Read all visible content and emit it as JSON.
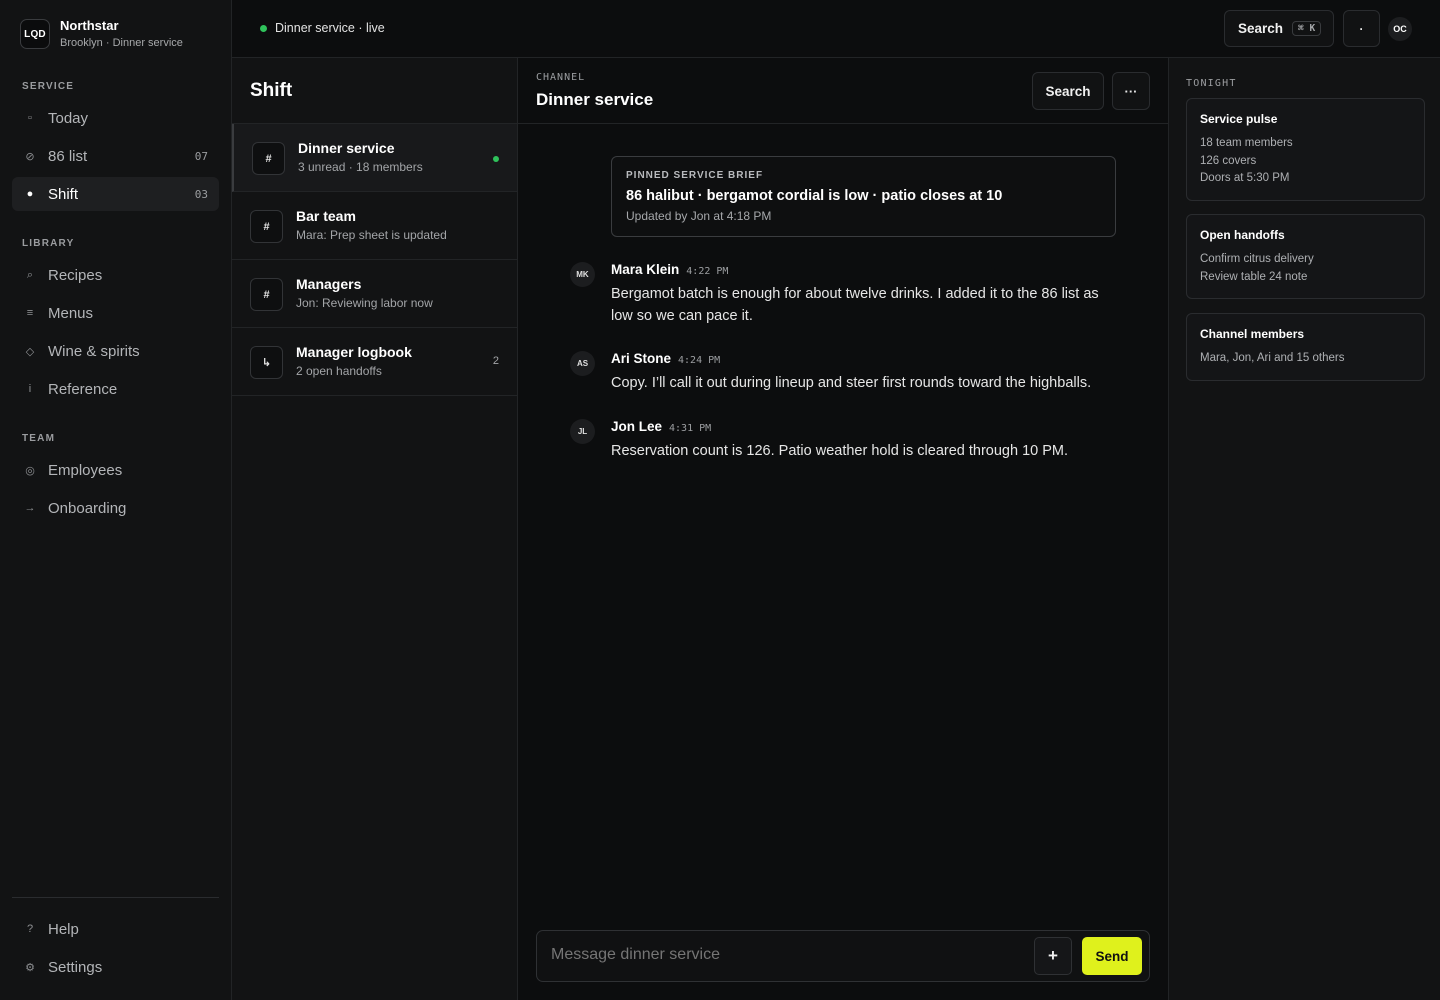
{
  "brand": {
    "logo": "LQD",
    "name": "Northstar",
    "subtitle": "Brooklyn · Dinner service"
  },
  "sidebar": {
    "sections": {
      "service": "SERVICE",
      "library": "LIBRARY",
      "team": "TEAM"
    },
    "service_items": [
      {
        "label": "Today",
        "icon": "calendar-icon",
        "glyph": "▫"
      },
      {
        "label": "86 list",
        "icon": "slash-icon",
        "glyph": "⊘",
        "count": "07"
      },
      {
        "label": "Shift",
        "icon": "radio-icon",
        "glyph": "●",
        "count": "03",
        "active": true
      }
    ],
    "library_items": [
      {
        "label": "Recipes",
        "icon": "search-icon",
        "glyph": "⌕"
      },
      {
        "label": "Menus",
        "icon": "list-icon",
        "glyph": "≡"
      },
      {
        "label": "Wine & spirits",
        "icon": "diamond-icon",
        "glyph": "◇"
      },
      {
        "label": "Reference",
        "icon": "info-icon",
        "glyph": "i"
      }
    ],
    "team_items": [
      {
        "label": "Employees",
        "icon": "people-icon",
        "glyph": "◎"
      },
      {
        "label": "Onboarding",
        "icon": "arrow-right-icon",
        "glyph": "→"
      }
    ],
    "bottom_items": [
      {
        "label": "Help",
        "icon": "help-icon",
        "glyph": "?"
      },
      {
        "label": "Settings",
        "icon": "gear-icon",
        "glyph": "⚙"
      }
    ]
  },
  "topbar": {
    "status": "Dinner service · live",
    "search_label": "Search",
    "shortcut": "⌘ K",
    "dot_button": "·",
    "avatar": "OC"
  },
  "channel_list": {
    "title": "Shift",
    "channels": [
      {
        "icon": "#",
        "name": "Dinner service",
        "sub": "3 unread · 18 members",
        "active": true,
        "live": true
      },
      {
        "icon": "#",
        "name": "Bar team",
        "sub": "Mara: Prep sheet is updated"
      },
      {
        "icon": "#",
        "name": "Managers",
        "sub": "Jon: Reviewing labor now"
      },
      {
        "icon": "↳",
        "name": "Manager logbook",
        "sub": "2 open handoffs",
        "count": "2"
      }
    ]
  },
  "main": {
    "eyebrow": "CHANNEL",
    "title": "Dinner service",
    "search_label": "Search",
    "more_label": "···",
    "pinned": {
      "label": "PINNED SERVICE BRIEF",
      "title": "86 halibut · bergamot cordial is low · patio closes at 10",
      "sub": "Updated by Jon at 4:18 PM"
    },
    "messages": [
      {
        "initials": "MK",
        "author": "Mara Klein",
        "time": "4:22 PM",
        "body": "Bergamot batch is enough for about twelve drinks. I added it to the 86 list as low so we can pace it."
      },
      {
        "initials": "AS",
        "author": "Ari Stone",
        "time": "4:24 PM",
        "body": "Copy. I’ll call it out during lineup and steer first rounds toward the highballs."
      },
      {
        "initials": "JL",
        "author": "Jon Lee",
        "time": "4:31 PM",
        "body": "Reservation count is 126. Patio weather hold is cleared through 10 PM."
      }
    ],
    "composer": {
      "placeholder": "Message dinner service",
      "plus": "+",
      "send": "Send"
    }
  },
  "right_panel": {
    "label": "TONIGHT",
    "cards": [
      {
        "title": "Service pulse",
        "lines": [
          "18 team members",
          "126 covers",
          "Doors at 5:30 PM"
        ]
      },
      {
        "title": "Open handoffs",
        "lines": [
          "Confirm citrus delivery",
          "Review table 24 note"
        ]
      },
      {
        "title": "Channel members",
        "lines": [
          "Mara, Jon, Ari and 15 others"
        ]
      }
    ]
  },
  "colors": {
    "accent": "#dff11c",
    "live": "#2fc25b",
    "background": "#0c0d0e",
    "panel": "#121314"
  }
}
